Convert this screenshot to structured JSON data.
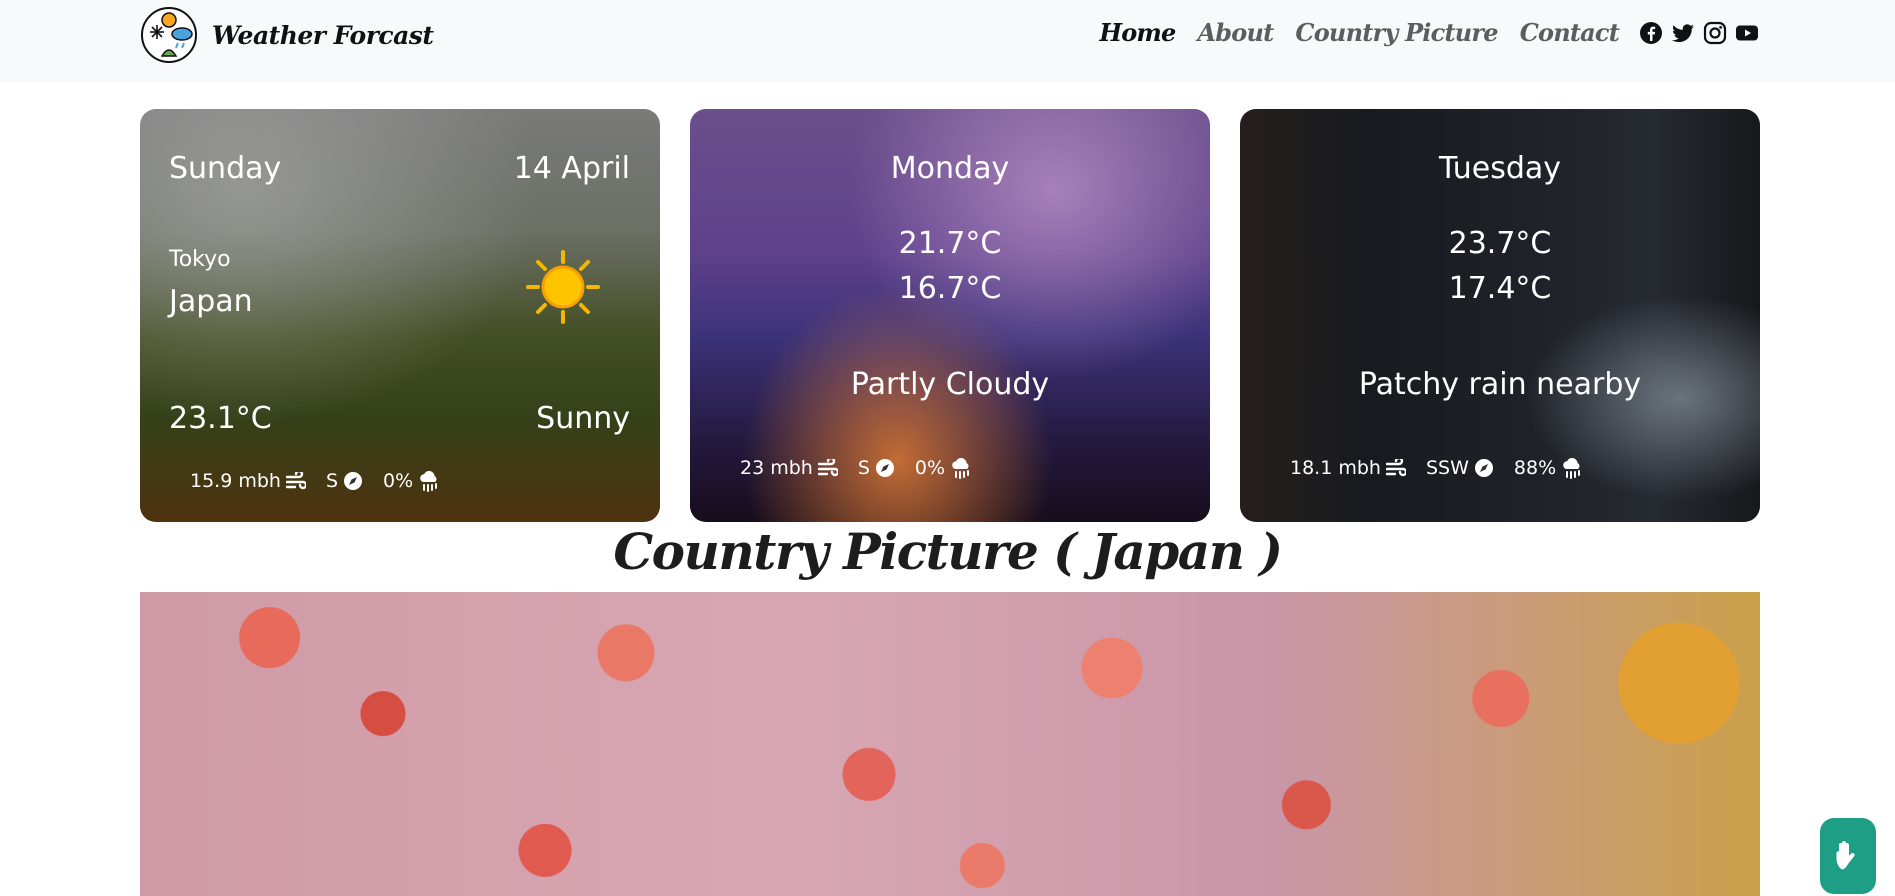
{
  "navbar": {
    "brand": "Weather Forcast",
    "links": [
      "Home",
      "About",
      "Country Picture",
      "Contact"
    ],
    "social": [
      "facebook-icon",
      "twitter-icon",
      "instagram-icon",
      "youtube-icon"
    ]
  },
  "cards": [
    {
      "day": "Sunday",
      "date": "14 April",
      "city": "Tokyo",
      "country": "Japan",
      "temp": "23.1°C",
      "condition": "Sunny",
      "condition_icon": "sun-icon",
      "wind": "15.9 mbh",
      "direction": "S",
      "rain": "0%"
    },
    {
      "day": "Monday",
      "max": "21.7°C",
      "min": "16.7°C",
      "condition": "Partly Cloudy",
      "wind": "23 mbh",
      "direction": "S",
      "rain": "0%"
    },
    {
      "day": "Tuesday",
      "max": "23.7°C",
      "min": "17.4°C",
      "condition": "Patchy rain nearby",
      "wind": "18.1 mbh",
      "direction": "SSW",
      "rain": "88%"
    }
  ],
  "section_title": "Country Picture ( Japan )",
  "colors": {
    "accent": "#1e9e84",
    "navbar_bg": "#f8f9fa"
  }
}
